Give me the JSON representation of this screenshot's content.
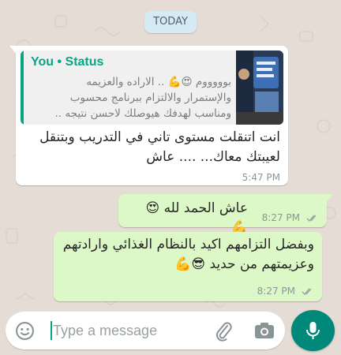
{
  "date_separator": "TODAY",
  "messages": [
    {
      "direction": "incoming",
      "quoted": {
        "author": "You • Status",
        "lines": [
          "بوووووم 😍💪 .. الاراده والعزيمه",
          "والإستمرار والالتزام ببرنامج محسوب",
          "ومناسب لهدفك هيوصلك لاحسن نتيجه .."
        ],
        "thumbnail_icon": "status-photo-thumbnail"
      },
      "text_lines": [
        "انت اتنقلت مستوى تاني في التدريب وبتنقل",
        "لعيبتك معاك... .... عاش"
      ],
      "time": "5:47 PM"
    },
    {
      "direction": "outgoing",
      "text_lines": [
        "عاش الحمد لله 😍💪"
      ],
      "time": "8:27 PM",
      "status_icon": "double-check-icon"
    },
    {
      "direction": "outgoing",
      "text_lines": [
        "وبفضل التزامهم اكيد بالنظام الغذائي وارادتهم",
        "وعزيمتهم من حديد 😎💪"
      ],
      "time": "8:27 PM",
      "status_icon": "double-check-icon"
    }
  ],
  "composer": {
    "placeholder": "Type a message",
    "value": "",
    "emoji_icon": "emoji-icon",
    "attach_icon": "paperclip-icon",
    "camera_icon": "camera-icon",
    "send_icon": "microphone-icon"
  },
  "colors": {
    "background": "#e5ddd5",
    "incoming_bubble": "#ffffff",
    "outgoing_bubble": "#dcf8c6",
    "accent": "#06a684",
    "mic_button": "#00897b",
    "date_pill": "#d4eaf4"
  }
}
